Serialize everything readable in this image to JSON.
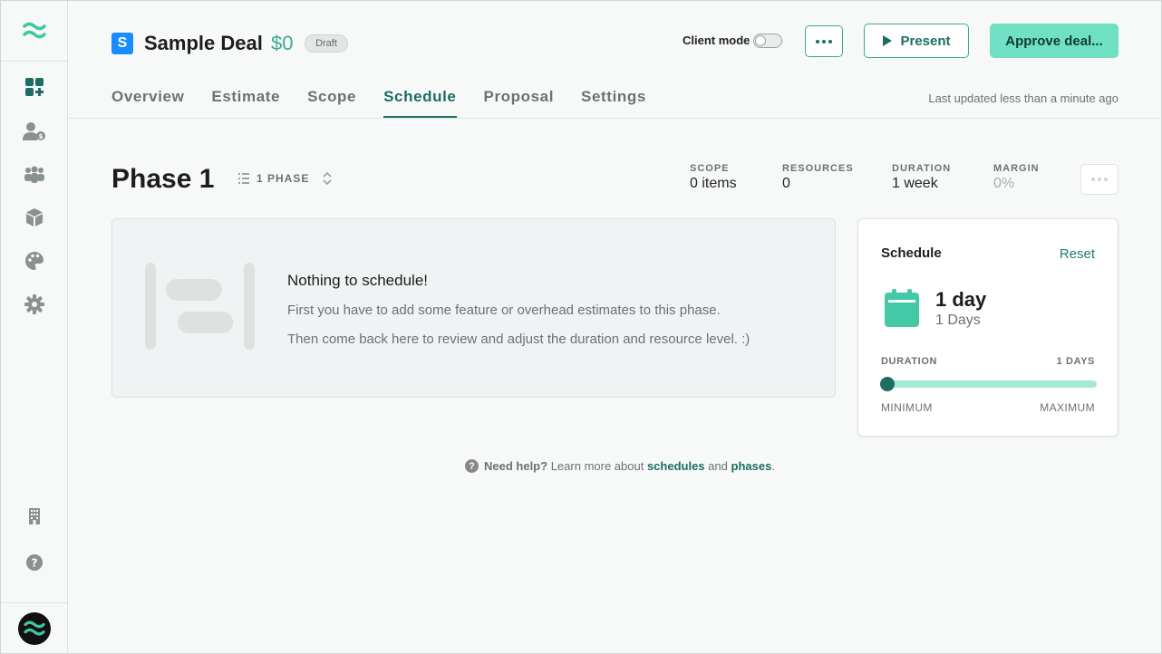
{
  "deal": {
    "badge_letter": "S",
    "title": "Sample Deal",
    "amount": "$0",
    "status": "Draft"
  },
  "header": {
    "client_mode_label": "Client mode",
    "present_label": "Present",
    "approve_label": "Approve deal...",
    "last_updated": "Last updated less than a minute ago",
    "tabs": [
      {
        "label": "Overview"
      },
      {
        "label": "Estimate"
      },
      {
        "label": "Scope"
      },
      {
        "label": "Schedule"
      },
      {
        "label": "Proposal"
      },
      {
        "label": "Settings"
      }
    ],
    "active_tab": "Schedule"
  },
  "sidebar": {
    "items": [
      "dashboard-icon",
      "clients-icon",
      "team-icon",
      "products-icon",
      "palette-icon",
      "settings-icon"
    ],
    "bottom": [
      "company-icon",
      "help-icon"
    ]
  },
  "phase": {
    "title": "Phase 1",
    "selector_label": "1 PHASE",
    "stats": [
      {
        "label": "SCOPE",
        "value": "0 items"
      },
      {
        "label": "RESOURCES",
        "value": "0"
      },
      {
        "label": "DURATION",
        "value": "1 week"
      },
      {
        "label": "MARGIN",
        "value": "0%"
      }
    ]
  },
  "empty_state": {
    "heading": "Nothing to schedule!",
    "line1": "First you have to add some feature or overhead estimates to this phase.",
    "line2": "Then come back here to review and adjust the duration and resource level. :)"
  },
  "schedule": {
    "title": "Schedule",
    "reset_label": "Reset",
    "value": "1 day",
    "value_sub": "1 Days",
    "duration_label": "DURATION",
    "duration_value": "1 DAYS",
    "min_label": "MINIMUM",
    "max_label": "MAXIMUM",
    "slider_position": 0
  },
  "help": {
    "prefix": "Need help?",
    "text1": "Learn more about",
    "link1": "schedules",
    "and": "and",
    "link2": "phases",
    "end": "."
  },
  "colors": {
    "accent": "#1c6e63",
    "accent_light": "#6fe0c3",
    "amount": "#3aaa8c",
    "badge": "#1a8cff"
  }
}
